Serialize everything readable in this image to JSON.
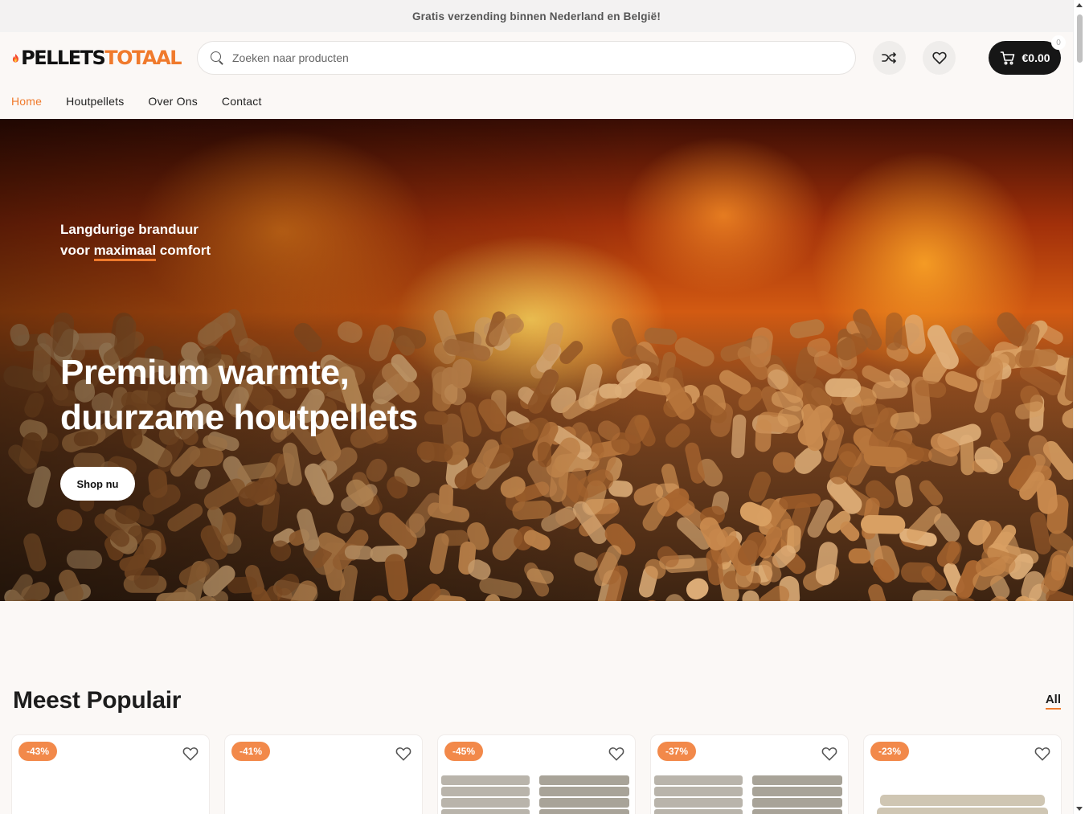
{
  "topbar": {
    "text": "Gratis verzending binnen Nederland en België!"
  },
  "logo": {
    "part1": "PELLETS",
    "part2": "TOTAAL",
    "icon": "flame-icon"
  },
  "search": {
    "placeholder": "Zoeken naar producten",
    "value": ""
  },
  "header": {
    "compare_icon": "shuffle-icon",
    "wishlist_icon": "heart-icon",
    "cart_total": "€0.00",
    "cart_count": "0"
  },
  "nav": {
    "items": [
      {
        "label": "Home",
        "active": true
      },
      {
        "label": "Houtpellets"
      },
      {
        "label": "Over Ons"
      },
      {
        "label": "Contact"
      }
    ]
  },
  "hero": {
    "sub_line1": "Langdurige branduur",
    "sub_line2_a": "voor ",
    "sub_line2_hl": "maximaal",
    "sub_line2_b": " comfort",
    "title_line1": "Premium warmte,",
    "title_line2": "duurzame houtpellets",
    "cta": "Shop nu"
  },
  "section": {
    "title": "Meest Populair",
    "link": "All"
  },
  "products": [
    {
      "badge": "-43%"
    },
    {
      "badge": "-41%"
    },
    {
      "badge": "-45%"
    },
    {
      "badge": "-37%"
    },
    {
      "badge": "-23%"
    }
  ],
  "colors": {
    "accent": "#f07a2c",
    "badge": "#f2894a",
    "dark": "#161616"
  }
}
